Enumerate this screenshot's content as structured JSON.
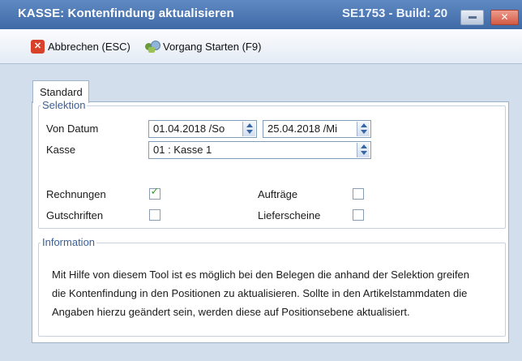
{
  "window": {
    "title": "KASSE: Kontenfindung aktualisieren",
    "build": "SE1753 - Build: 20",
    "close_glyph": "✕"
  },
  "toolbar": {
    "cancel_label": "Abbrechen (ESC)",
    "cancel_icon": "close-red-icon",
    "start_label": "Vorgang Starten (F9)",
    "start_icon": "process-gears-icon"
  },
  "tab": {
    "label": "Standard"
  },
  "selektion": {
    "legend": "Selektion",
    "von_datum_label": "Von Datum",
    "date_from": "01.04.2018 /So",
    "date_to": "25.04.2018 /Mi",
    "kasse_label": "Kasse",
    "kasse_value": "01 : Kasse 1",
    "checkboxes": [
      {
        "label": "Rechnungen",
        "checked": true
      },
      {
        "label": "Gutschriften",
        "checked": false
      },
      {
        "label": "Aufträge",
        "checked": false
      },
      {
        "label": "Lieferscheine",
        "checked": false
      }
    ],
    "check_glyph": "✓"
  },
  "information": {
    "legend": "Information",
    "lines": [
      "Mit Hilfe von diesem Tool ist es möglich bei den Belegen die anhand der Selektion greifen",
      "die Kontenfindung in den Positionen zu aktualisieren. Sollte in den Artikelstammdaten die",
      "Angaben hierzu geändert sein, werden diese auf Positionsebene aktualisiert."
    ]
  },
  "colors": {
    "titlebar": "#4a76b3",
    "background": "#d3deec",
    "accent": "#3a5f97",
    "check": "#3e9a2c"
  }
}
